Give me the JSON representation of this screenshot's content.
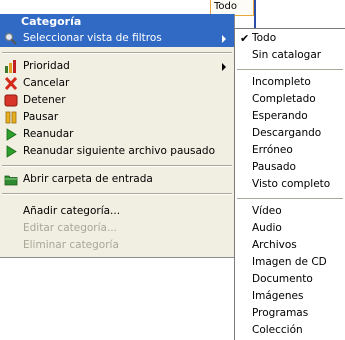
{
  "background": {
    "tab_label": "Todo"
  },
  "menu": {
    "title": "Categoría",
    "items": [
      {
        "label": "Seleccionar vista de filtros",
        "icon": "magnifier-icon",
        "submenu": true,
        "highlighted": true
      },
      {
        "label": "Prioridad",
        "icon": "priority-bars-icon",
        "submenu": true
      },
      {
        "label": "Cancelar",
        "icon": "red-x-icon"
      },
      {
        "label": "Detener",
        "icon": "stop-icon"
      },
      {
        "label": "Pausar",
        "icon": "pause-icon"
      },
      {
        "label": "Reanudar",
        "icon": "play-icon"
      },
      {
        "label": "Reanudar siguiente archivo pausado",
        "icon": "play-icon"
      },
      {
        "label": "Abrir carpeta de entrada",
        "icon": "folder-icon"
      },
      {
        "label": "Añadir categoría..."
      },
      {
        "label": "Editar categoría...",
        "disabled": true
      },
      {
        "label": "Eliminar categoría",
        "disabled": true
      }
    ]
  },
  "submenu": {
    "group1": [
      "Todo",
      "Sin catalogar"
    ],
    "group2": [
      "Incompleto",
      "Completado",
      "Esperando",
      "Descargando",
      "Erróneo",
      "Pausado",
      "Visto completo"
    ],
    "group3": [
      "Vídeo",
      "Audio",
      "Archivos",
      "Imagen de CD",
      "Documento",
      "Imágenes",
      "Programas",
      "Colección"
    ],
    "checked": "Todo"
  },
  "colors": {
    "highlight": "#316ac5",
    "menu_bg": "#f1efe2",
    "disabled_text": "#a8a696"
  }
}
